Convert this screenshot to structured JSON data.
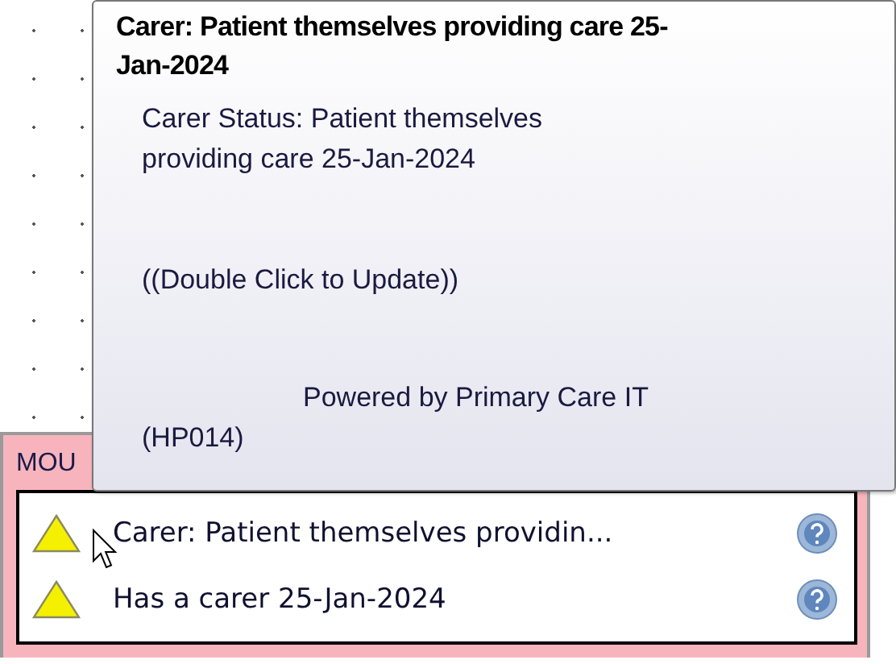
{
  "tooltip": {
    "title": "Carer: Patient themselves providing care 25-Jan-2024",
    "status": "Carer Status: Patient themselves providing care 25-Jan-2024",
    "hint": "((Double Click to Update))",
    "footer": "Powered by Primary Care IT (HP014)"
  },
  "panel": {
    "label": "MOU"
  },
  "alerts": [
    {
      "text": "Carer: Patient themselves providin..."
    },
    {
      "text": "Has a carer 25-Jan-2024"
    }
  ]
}
